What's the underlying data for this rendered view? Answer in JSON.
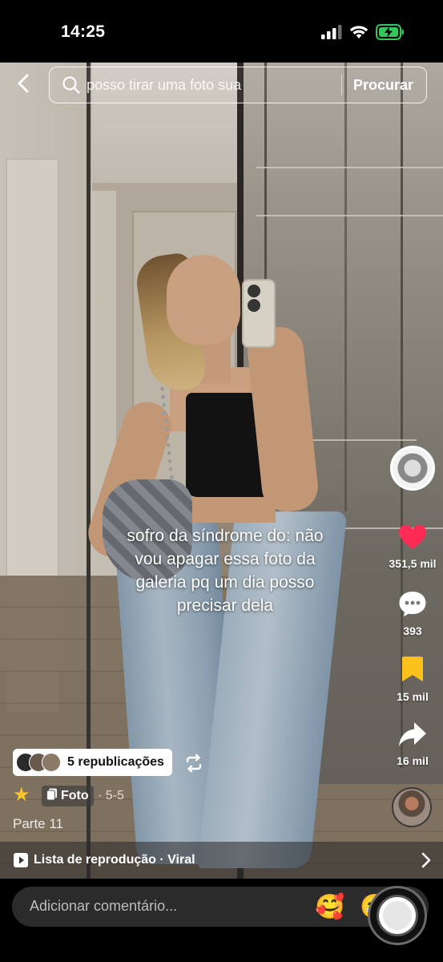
{
  "status_bar": {
    "time": "14:25",
    "icons": [
      "signal-icon",
      "wifi-icon",
      "battery-charging-icon"
    ],
    "battery_color": "#34c759"
  },
  "search": {
    "query": "posso tirar uma foto sua",
    "submit_label": "Procurar",
    "back_icon": "chevron-left-icon"
  },
  "caption": {
    "lines": [
      "sofro da síndrome do: não",
      "vou apagar essa foto da",
      "galeria pq um dia posso",
      "precisar dela"
    ]
  },
  "actions": {
    "like_count": "351,5 mil",
    "like_color": "#fe2c55",
    "comment_count": "393",
    "save_count": "15 mil",
    "save_color": "#fcc21b",
    "share_count": "16 mil"
  },
  "post_info": {
    "reposts_label": "5 republicações",
    "type_label": "Foto",
    "date": "· 5-5",
    "part_label": "Parte 11"
  },
  "playlist": {
    "label": "Lista de reprodução · Viral"
  },
  "comment_bar": {
    "placeholder": "Adicionar comentário...",
    "emoji_1": "🥰",
    "emoji_2": "😁"
  }
}
